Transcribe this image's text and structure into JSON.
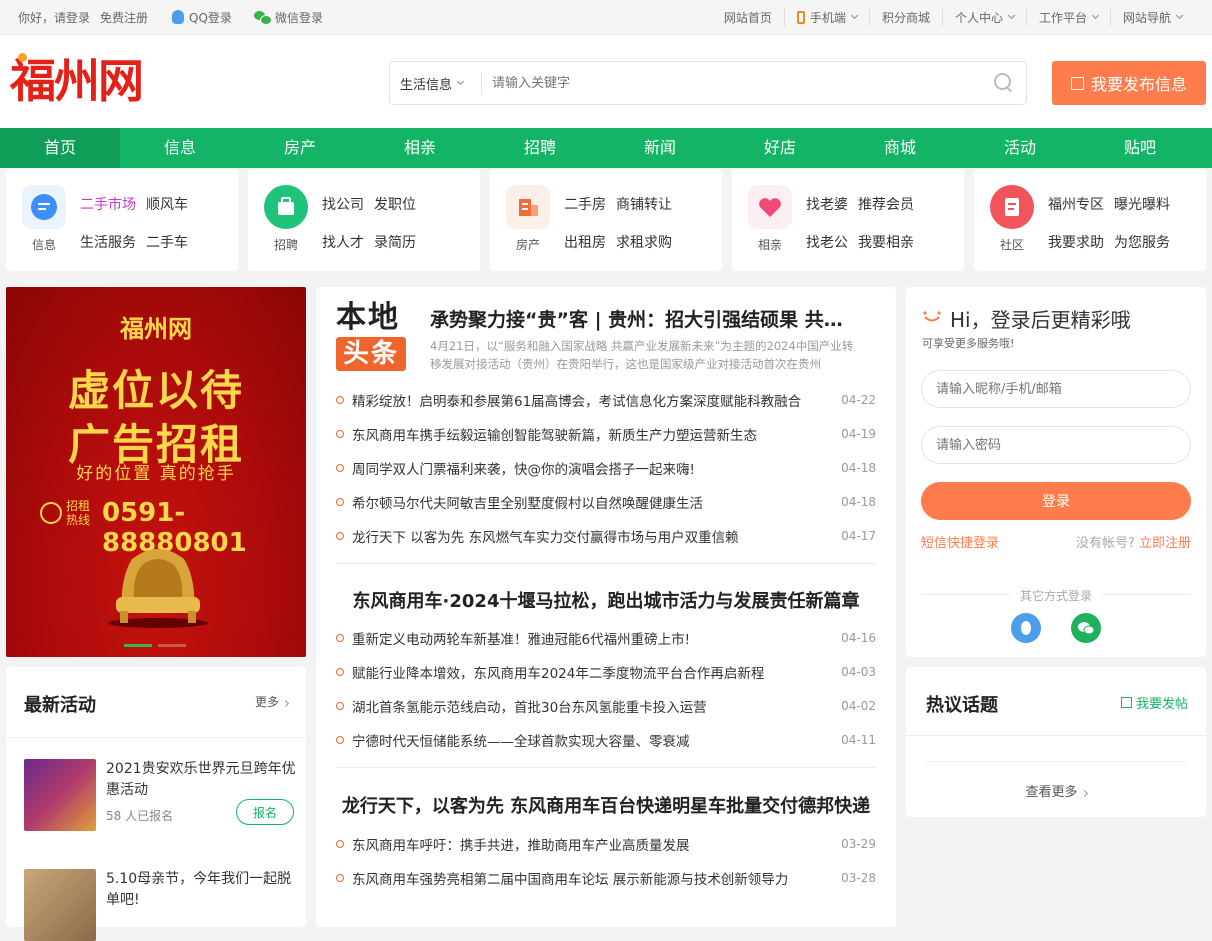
{
  "topbar": {
    "greeting": "你好，请登录",
    "register": "免费注册",
    "qq_login": "QQ登录",
    "wechat_login": "微信登录",
    "right": [
      "网站首页",
      "手机端",
      "积分商城",
      "个人中心",
      "工作平台",
      "网站导航"
    ]
  },
  "header": {
    "logo": "福州网",
    "search_category": "生活信息",
    "search_placeholder": "请输入关键字",
    "publish": "我要发布信息"
  },
  "nav": [
    "首页",
    "信息",
    "房产",
    "相亲",
    "招聘",
    "新闻",
    "好店",
    "商城",
    "活动",
    "贴吧"
  ],
  "categories": [
    {
      "label": "信息",
      "links": [
        "二手市场",
        "顺风车",
        "生活服务",
        "二手车"
      ],
      "color": "#3d8ff5"
    },
    {
      "label": "招聘",
      "links": [
        "找公司",
        "发职位",
        "找人才",
        "录简历"
      ],
      "color": "#1fc47a"
    },
    {
      "label": "房产",
      "links": [
        "二手房",
        "商铺转让",
        "出租房",
        "求租求购"
      ],
      "color": "#f36a3b"
    },
    {
      "label": "相亲",
      "links": [
        "找老婆",
        "推荐会员",
        "找老公",
        "我要相亲"
      ],
      "color": "#ef4b74"
    },
    {
      "label": "社区",
      "links": [
        "福州专区",
        "曝光曝料",
        "我要求助",
        "为您服务"
      ],
      "color": "#f2545b"
    }
  ],
  "banner": {
    "brand": "福州网",
    "line1": "虚位以待",
    "line2": "广告招租",
    "slogan": "好的位置 真的抢手",
    "hotline_label": "招租热线",
    "hotline": "0591-88880801"
  },
  "news": {
    "logo_top": "本地",
    "logo_bottom": "头条",
    "headline": "承势聚力接“贵”客 | 贵州：招大引强结硕果 共…",
    "summary": "4月21日，以“服务和融入国家战略 共赢产业发展新未来”为主题的2024中国产业转移发展对接活动（贵州）在贵阳举行，这也是国家级产业对接活动首次在贵州",
    "group1": [
      {
        "title": "精彩绽放！启明泰和参展第61届高博会，考试信息化方案深度赋能科教融合",
        "date": "04-22"
      },
      {
        "title": "东风商用车携手纭毅运输创智能驾驶新篇，新质生产力塑运营新生态",
        "date": "04-19"
      },
      {
        "title": "周同学双人门票福利来袭，快@你的演唱会搭子一起来嗨!",
        "date": "04-18"
      },
      {
        "title": "希尔顿马尔代夫阿敏吉里全别墅度假村以自然唤醒健康生活",
        "date": "04-18"
      },
      {
        "title": "龙行天下 以客为先 东风燃气车实力交付赢得市场与用户双重信赖",
        "date": "04-17"
      }
    ],
    "subhead1": "东风商用车·2024十堰马拉松，跑出城市活力与发展责任新篇章",
    "group2": [
      {
        "title": "重新定义电动两轮车新基准！雅迪冠能6代福州重磅上市!",
        "date": "04-16"
      },
      {
        "title": "赋能行业降本增效，东风商用车2024年二季度物流平台合作再启新程",
        "date": "04-03"
      },
      {
        "title": "湖北首条氢能示范线启动，首批30台东风氢能重卡投入运营",
        "date": "04-02"
      },
      {
        "title": "宁德时代天恒储能系统——全球首款实现大容量、零衰减",
        "date": "04-11"
      }
    ],
    "subhead2": "龙行天下，以客为先 东风商用车百台快递明星车批量交付德邦快递",
    "group3": [
      {
        "title": "东风商用车呼吁：携手共进，推助商用车产业高质量发展",
        "date": "03-29"
      },
      {
        "title": "东风商用车强势亮相第二届中国商用车论坛 展示新能源与技术创新领导力",
        "date": "03-28"
      }
    ]
  },
  "login": {
    "title": "Hi，登录后更精彩哦",
    "subtitle": "可享受更多服务哦!",
    "user_placeholder": "请输入昵称/手机/邮箱",
    "pass_placeholder": "请输入密码",
    "button": "登录",
    "sms": "短信快捷登录",
    "no_account": "没有帐号?",
    "register": "立即注册",
    "other": "其它方式登录"
  },
  "activities": {
    "title": "最新活动",
    "more": "更多",
    "items": [
      {
        "title": "2021贵安欢乐世界元旦跨年优惠活动",
        "count": "58 人已报名",
        "button": "报名"
      },
      {
        "title": "5.10母亲节，今年我们一起脱单吧!",
        "count": "",
        "button": ""
      }
    ]
  },
  "hot": {
    "title": "热议话题",
    "post": "我要发帖",
    "more": "查看更多"
  }
}
